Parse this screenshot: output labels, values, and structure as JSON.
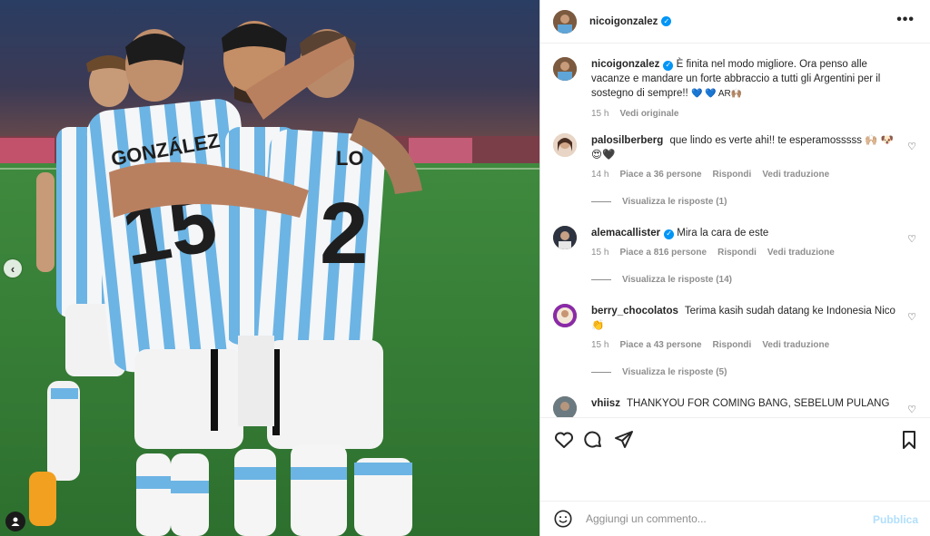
{
  "post": {
    "author": "nicoigonzalez",
    "caption_text": "È finita nel modo migliore. Ora penso alle vacanze e mandare un forte abbraccio a tutti gli Argentini per il sostegno di sempre!!",
    "caption_emoji": "💙 💙 AR🙌🏽",
    "time": "15 h",
    "see_original": "Vedi originale",
    "more_icon": "•••"
  },
  "comments": [
    {
      "user": "palosilberberg",
      "text": "que lindo es verte ahi!! te esperamosssss 🙌🏼 🐶 😍🖤",
      "time": "14 h",
      "likes": "Piace a 36 persone",
      "reply": "Rispondi",
      "translate": "Vedi traduzione",
      "replies": "Visualizza le risposte (1)"
    },
    {
      "user": "alemacallister",
      "text": "Mira la cara de este",
      "time": "15 h",
      "likes": "Piace a 816 persone",
      "reply": "Rispondi",
      "translate": "Vedi traduzione",
      "replies": "Visualizza le risposte (14)"
    },
    {
      "user": "berry_chocolatos",
      "text": "Terima kasih sudah datang ke Indonesia Nico 👏",
      "time": "15 h",
      "likes": "Piace a 43 persone",
      "reply": "Rispondi",
      "translate": "Vedi traduzione",
      "replies": "Visualizza le risposte (5)"
    },
    {
      "user": "vhiisz",
      "text": "THANKYOU FOR COMING BANG, SEBELUM PULANG"
    }
  ],
  "compose": {
    "placeholder": "Aggiungi un commento...",
    "publish": "Pubblica"
  },
  "media": {
    "jersey_names": [
      "GONZÁLEZ",
      "LO"
    ],
    "jersey_numbers": [
      "15",
      "2"
    ]
  },
  "colors": {
    "accent": "#0095f6",
    "publish_disabled": "#b2dffc",
    "muted_text": "#8e8e8e"
  }
}
